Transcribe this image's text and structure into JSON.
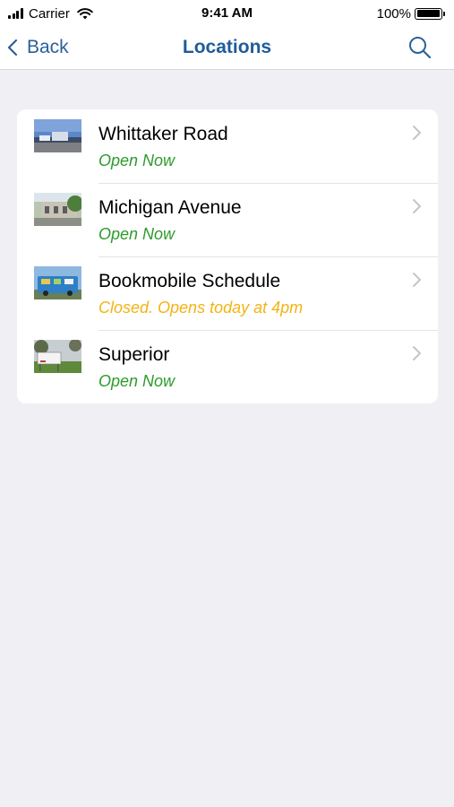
{
  "status_bar": {
    "carrier": "Carrier",
    "time": "9:41 AM",
    "battery": "100%",
    "battery_level": 1.0
  },
  "nav": {
    "back_label": "Back",
    "title": "Locations",
    "accent_color": "#1F5C99"
  },
  "locations": [
    {
      "name": "Whittaker Road",
      "status": "Open Now",
      "status_type": "open",
      "thumbnail": "library-building-photo"
    },
    {
      "name": "Michigan Avenue",
      "status": "Open Now",
      "status_type": "open",
      "thumbnail": "library-building-photo"
    },
    {
      "name": "Bookmobile Schedule",
      "status": "Closed. Opens today at 4pm",
      "status_type": "closed",
      "thumbnail": "bookmobile-photo"
    },
    {
      "name": "Superior",
      "status": "Open Now",
      "status_type": "open",
      "thumbnail": "library-sign-photo"
    }
  ],
  "colors": {
    "open": "#2C9B2C",
    "closed": "#F3B313",
    "background": "#EFEFF4"
  }
}
